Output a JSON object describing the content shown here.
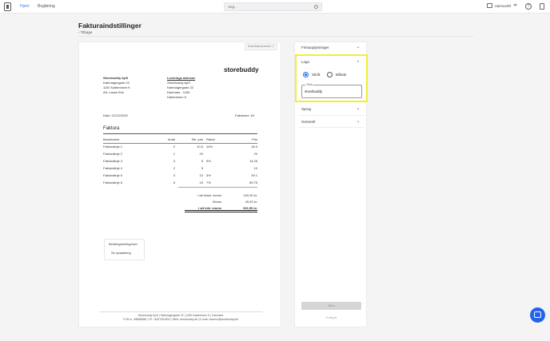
{
  "nav": {
    "home": "Hjem",
    "bookkeeping": "Bogføring",
    "search_placeholder": "Søg...",
    "user": "rasmuxlOl"
  },
  "page": {
    "title": "Fakturaindstillinger",
    "back": "Tilbage"
  },
  "invoice": {
    "download_preview": "Download preview ⓘ",
    "brand": "storebuddy",
    "sender": {
      "name": "Storebuddy ApS",
      "street": "Købmagergade 22",
      "city": "1150 København K",
      "att": "Att. Lasse Kirk"
    },
    "shipping": {
      "heading": "Leverings adresse",
      "name": "Storebuddy ApS",
      "street": "Købmagergade 22",
      "country": "Danmark - 1150",
      "city": "København K"
    },
    "date": "Dato: 21/12/2025",
    "number": "Fakturanr: 45",
    "section_title": "Faktura",
    "columns": [
      "Beskrivelse",
      "Antal",
      "Stk. pris",
      "Rabat",
      "Pris"
    ],
    "rows": [
      {
        "desc": "Fakturalinje 1",
        "qty": "2",
        "unit": "10.5",
        "rate": "10%",
        "price": "18.9"
      },
      {
        "desc": "Fakturalinje 2",
        "qty": "1",
        "unit": "20",
        "rate": "",
        "price": "20"
      },
      {
        "desc": "Fakturalinje 3",
        "qty": "3",
        "unit": "5",
        "rate": "5%",
        "price": "14.25"
      },
      {
        "desc": "Fakturalinje 4",
        "qty": "2",
        "unit": "5",
        "rate": "",
        "price": "10"
      },
      {
        "desc": "Fakturalinje 5",
        "qty": "3",
        "unit": "10",
        "rate": "3%",
        "price": "29.1"
      },
      {
        "desc": "Fakturalinje 6",
        "qty": "5",
        "unit": "15",
        "rate": "7%",
        "price": "69.75"
      }
    ],
    "totals": {
      "excl_label": "I alt ekskl. moms",
      "excl_value": "162,00 kr.",
      "vat_label": "Moms",
      "vat_value": "40,50 kr.",
      "incl_label": "I alt inkl. moms",
      "incl_value": "202,50 kr."
    },
    "payment": {
      "title": "Betalingsbetingelser",
      "button": "Se opsætning"
    },
    "footer_line1": "Storebuddy ApS | Købmagergade 22 | 1150 København K | Danmark",
    "footer_line2": "CVR-nr. 38868688 | Tlf. +4527451504 | Web: storebuddy.dk | E-mail: rasmus@storebuddy.dk"
  },
  "settings": {
    "sections": [
      "Firmaoplysninger",
      "Logo",
      "Sprog",
      "Generelt"
    ],
    "logo": {
      "option_text": "Skrift",
      "option_image": "Billede",
      "selected": "Skrift",
      "field_label": "Tekst",
      "field_value": "storebuddy"
    },
    "save": "Gem",
    "remove": "Fortryd"
  },
  "colors": {
    "accent": "#2563eb",
    "highlight": "#f2ee31"
  }
}
